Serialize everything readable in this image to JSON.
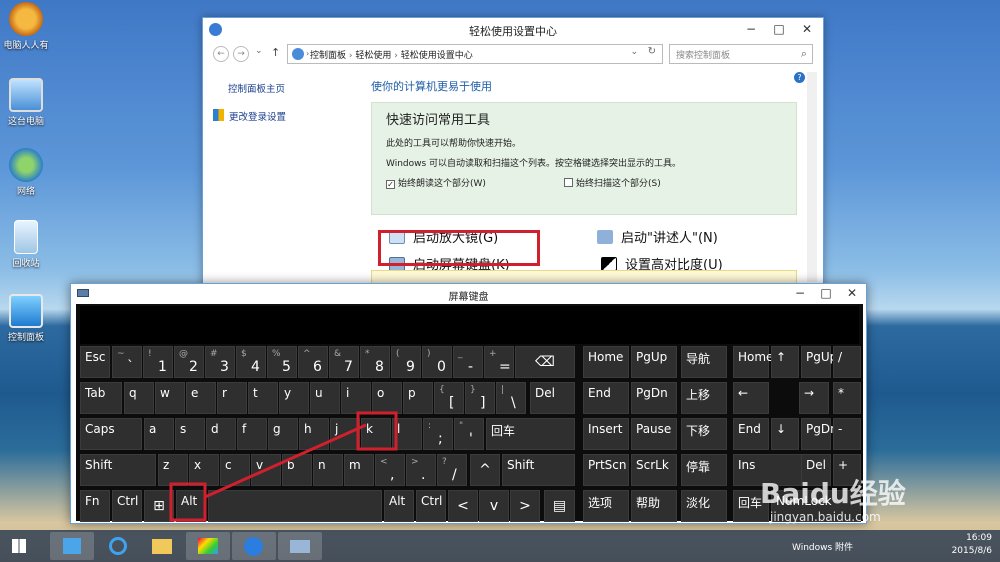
{
  "desktop": {
    "icons": [
      {
        "label": "电脑人人有",
        "icon": "lion-logo-icon"
      },
      {
        "label": "这台电脑",
        "icon": "computer-icon"
      },
      {
        "label": "网络",
        "icon": "network-icon"
      },
      {
        "label": "回收站",
        "icon": "recycle-bin-icon"
      },
      {
        "label": "控制面板",
        "icon": "control-panel-icon"
      }
    ]
  },
  "control_panel": {
    "title": "轻松使用设置中心",
    "breadcrumb": [
      "控制面板",
      "轻松使用",
      "轻松使用设置中心"
    ],
    "search_placeholder": "搜索控制面板",
    "left_links": [
      "控制面板主页",
      "更改登录设置"
    ],
    "heading": "使你的计算机更易于使用",
    "quick_access": {
      "title": "快速访问常用工具",
      "line1": "此处的工具可以帮助你快速开始。",
      "line2": "Windows 可以自动读取和扫描这个列表。按空格键选择突出显示的工具。",
      "checkbox1": "始终朗读这个部分(W)",
      "checkbox1_checked": true,
      "checkbox2": "始终扫描这个部分(S)",
      "checkbox2_checked": false,
      "checkmark": "✓"
    },
    "tools": {
      "magnifier": "启动放大镜(G)",
      "narrator": "启动\"讲述人\"(N)",
      "osk": "启动屏幕键盘(K)",
      "contrast": "设置高对比度(U)"
    }
  },
  "osk": {
    "title": "屏幕键盘",
    "rows": {
      "r1": [
        "Esc",
        "`",
        "1",
        "2",
        "3",
        "4",
        "5",
        "6",
        "7",
        "8",
        "9",
        "0",
        "-",
        "=",
        "⌫",
        "Home",
        "PgUp",
        "导航",
        "Home",
        "↑",
        "PgUp",
        "/"
      ],
      "r1_shift": [
        "~",
        "!",
        "@",
        "#",
        "$",
        "%",
        "^",
        "&",
        "*",
        "(",
        ")",
        "_",
        "+"
      ],
      "r2": [
        "Tab",
        "q",
        "w",
        "e",
        "r",
        "t",
        "y",
        "u",
        "i",
        "o",
        "p",
        "[",
        "]",
        "\\",
        "Del",
        "End",
        "PgDn",
        "上移",
        "←",
        "→",
        "*"
      ],
      "r2_shift": [
        "{",
        "}",
        "|"
      ],
      "r3": [
        "Caps",
        "a",
        "s",
        "d",
        "f",
        "g",
        "h",
        "j",
        "k",
        "l",
        ";",
        "'",
        "回车",
        "Insert",
        "Pause",
        "下移",
        "End",
        "↓",
        "PgDn",
        "-"
      ],
      "r3_shift": [
        ":",
        "\""
      ],
      "r4": [
        "Shift",
        "z",
        "x",
        "c",
        "v",
        "b",
        "n",
        "m",
        ",",
        ".",
        "/",
        "^",
        "Shift",
        "PrtScn",
        "ScrLk",
        "停靠",
        "Ins",
        "Del",
        "+"
      ],
      "r4_shift": [
        "<",
        ">",
        "?"
      ],
      "r5": [
        "Fn",
        "Ctrl",
        "⊞",
        "Alt",
        "Alt",
        "Ctrl",
        "<",
        "v",
        ">",
        "▤",
        "选项",
        "帮助",
        "淡化",
        "回车",
        "NumLock"
      ]
    }
  },
  "taskbar": {
    "apps": [
      "start-icon",
      "control-panel-icon",
      "ie-icon",
      "explorer-icon",
      "paint-icon",
      "sogou-icon",
      "osk-icon"
    ],
    "language": "Windows 附件",
    "time": "16:09",
    "date": "2015/8/6"
  },
  "watermark": {
    "brand": "Baidu经验",
    "url": "jingyan.baidu.com"
  },
  "colors": {
    "highlight_red": "#d0202e",
    "key_bg": "#2f2f2f",
    "heading_blue": "#1e5ea8"
  }
}
